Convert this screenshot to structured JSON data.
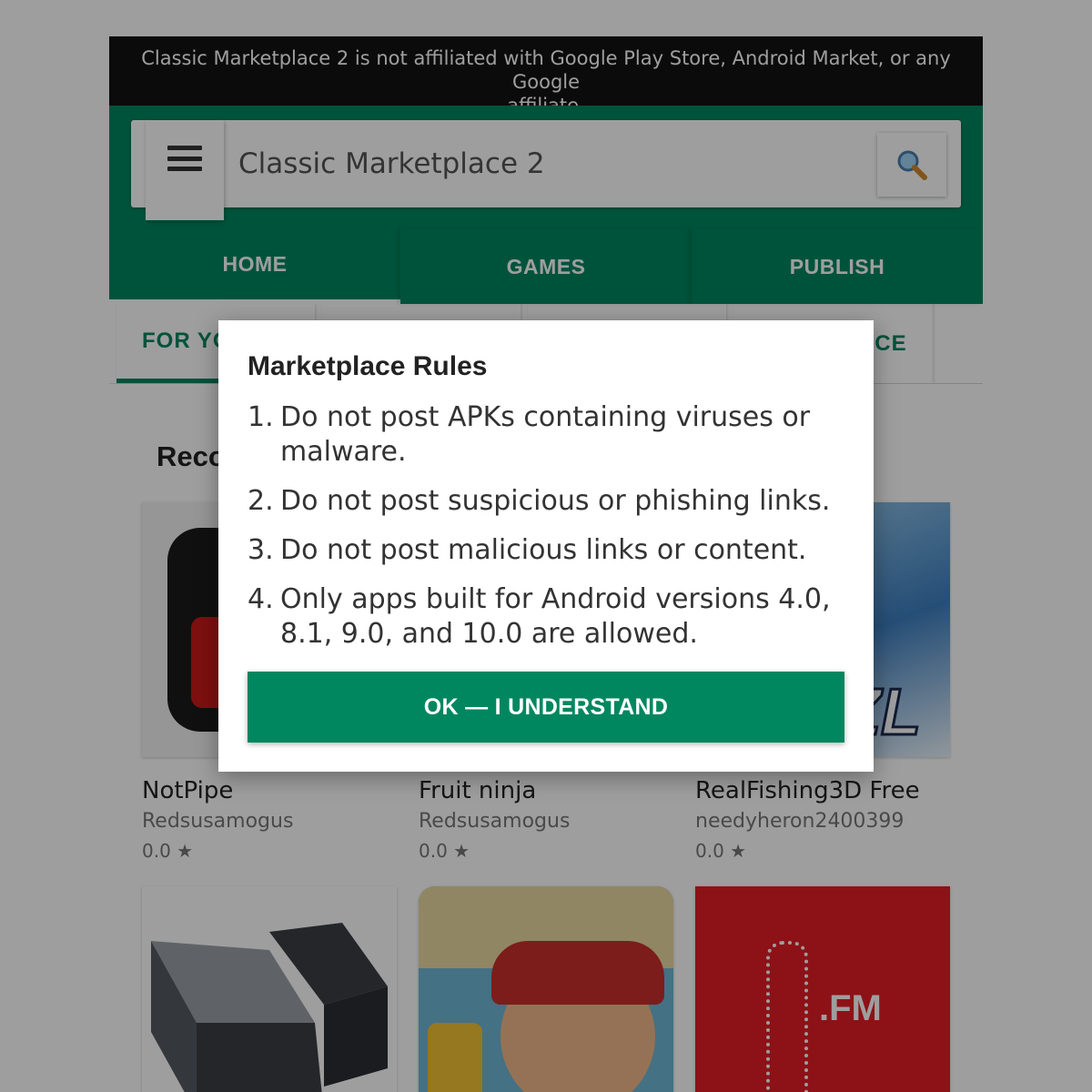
{
  "disclaimer": {
    "line1": "Classic Marketplace 2 is not affiliated with Google Play Store, Android Market, or any Google",
    "line2": "affiliate."
  },
  "search": {
    "title": "Classic Marketplace 2",
    "menu_icon": "hamburger-menu-icon",
    "search_icon": "magnifier-icon"
  },
  "tabs": [
    {
      "label": "HOME",
      "active": true
    },
    {
      "label": "GAMES",
      "active": false
    },
    {
      "label": "PUBLISH",
      "active": false
    }
  ],
  "subtabs": {
    "first_visible": "FOR YO",
    "last_visible": "CE"
  },
  "section": {
    "title_visible": "Reco"
  },
  "apps": [
    {
      "name": "NotPipe",
      "developer": "Redsusamogus",
      "rating": "0.0 ★"
    },
    {
      "name": "Fruit ninja",
      "developer": "Redsusamogus",
      "rating": "0.0 ★"
    },
    {
      "name": "RealFishing3D Free",
      "developer": "needyheron2400399",
      "rating": "0.0 ★"
    }
  ],
  "app_row2": {
    "cocacola_fm_label": ".FM"
  },
  "dialog": {
    "title": "Marketplace Rules",
    "rules": [
      {
        "num": "1.",
        "line1": "Do not post APKs containing viruses or",
        "line2": "malware."
      },
      {
        "num": "2.",
        "line1": "Do not post suspicious or phishing links.",
        "line2": ""
      },
      {
        "num": "3.",
        "line1": "Do not post malicious links or content.",
        "line2": ""
      },
      {
        "num": "4.",
        "line1": "Only apps built for Android versions 4.0,",
        "line2": "8.1, 9.0, and 10.0 are allowed."
      }
    ],
    "ok_label": "OK — I UNDERSTAND"
  },
  "colors": {
    "brand_green": "#01875f",
    "disclaimer_bg": "#121212",
    "overlay": "rgba(0,0,0,0.38)"
  }
}
